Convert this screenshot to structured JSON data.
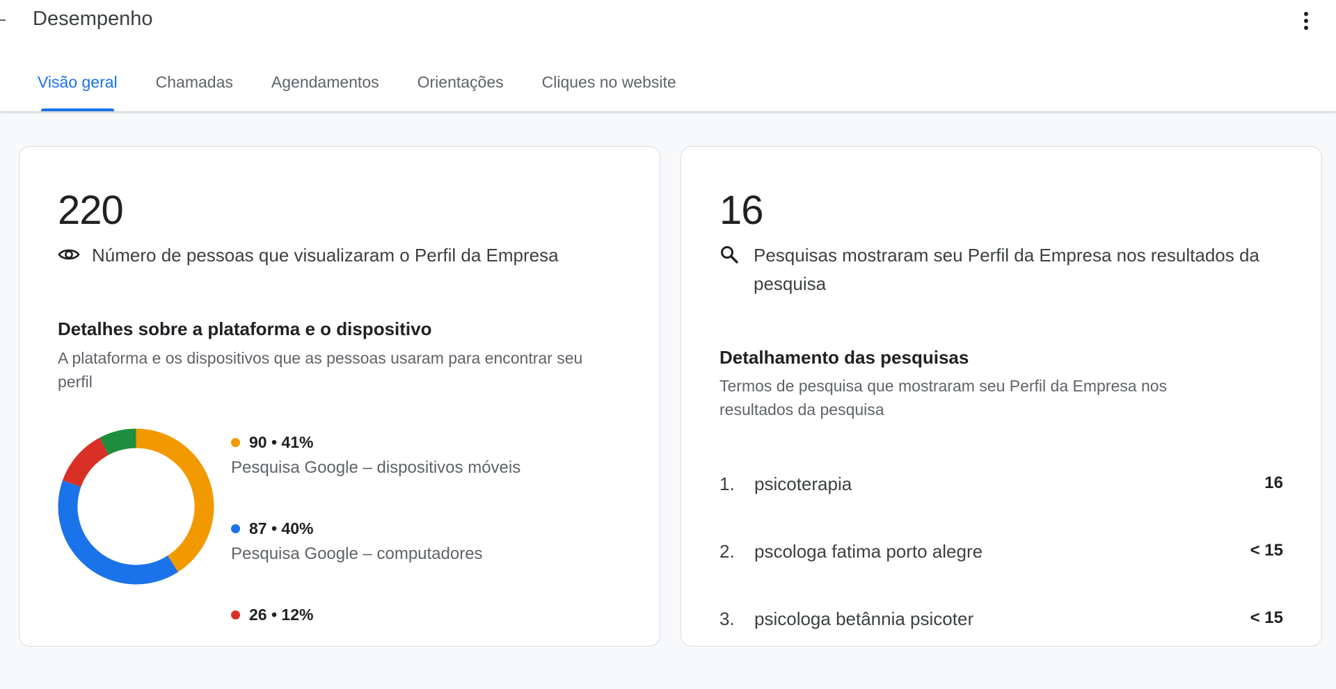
{
  "header": {
    "title": "Desempenho",
    "back_icon": "back-arrow-icon",
    "menu_icon": "more-vert-icon"
  },
  "tabs": [
    {
      "label": "Visão geral",
      "active": true
    },
    {
      "label": "Chamadas",
      "active": false
    },
    {
      "label": "Agendamentos",
      "active": false
    },
    {
      "label": "Orientações",
      "active": false
    },
    {
      "label": "Cliques no website",
      "active": false
    }
  ],
  "colors": {
    "accent": "#1a73e8",
    "mobile": "#f29900",
    "desktop": "#1a73e8",
    "maps_mobile": "#d93025",
    "maps_desktop": "#1e8e3e"
  },
  "views_card": {
    "value": "220",
    "icon": "eye-icon",
    "label": "Número de pessoas que visualizaram o Perfil da Empresa",
    "section_title": "Detalhes sobre a plataforma e o dispositivo",
    "section_desc": "A plataforma e os dispositivos que as pessoas usaram para encontrar seu perfil",
    "legend": [
      {
        "value": "90 • 41%",
        "label": "Pesquisa Google – dispositivos móveis",
        "color": "#f29900"
      },
      {
        "value": "87 • 40%",
        "label": "Pesquisa Google – computadores",
        "color": "#1a73e8"
      },
      {
        "value": "26 • 12%",
        "label": "",
        "color": "#d93025"
      }
    ]
  },
  "chart_data": {
    "type": "pie",
    "donut": true,
    "categories": [
      "Pesquisa Google – dispositivos móveis",
      "Pesquisa Google – computadores",
      "",
      ""
    ],
    "values": [
      90,
      87,
      26,
      17
    ],
    "percent": [
      41,
      40,
      12,
      7
    ],
    "colors": [
      "#f29900",
      "#1a73e8",
      "#d93025",
      "#1e8e3e"
    ]
  },
  "searches_card": {
    "value": "16",
    "icon": "search-icon",
    "label": "Pesquisas mostraram seu Perfil da Empresa nos resultados da pesquisa",
    "section_title": "Detalhamento das pesquisas",
    "section_desc": "Termos de pesquisa que mostraram seu Perfil da Empresa nos resultados da pesquisa",
    "terms": [
      {
        "index": "1.",
        "term": "psicoterapia",
        "count": "16"
      },
      {
        "index": "2.",
        "term": "pscologa fatima porto alegre",
        "count": "< 15"
      },
      {
        "index": "3.",
        "term": "psicologa betânnia psicoter",
        "count": "< 15"
      }
    ]
  }
}
